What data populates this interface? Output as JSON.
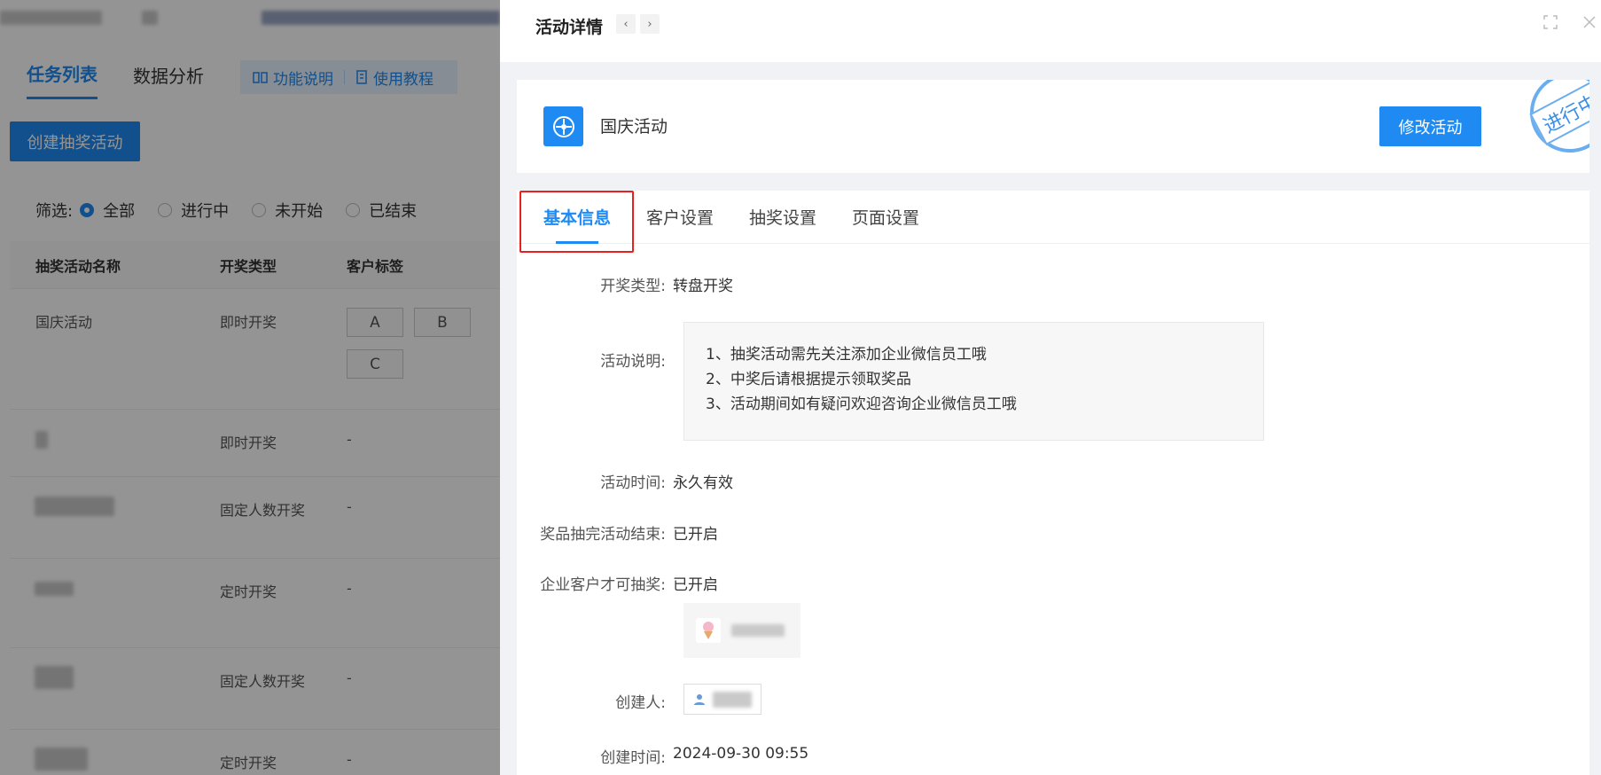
{
  "left": {
    "tabs": [
      "任务列表",
      "数据分析"
    ],
    "help_func": "功能说明",
    "help_tutorial": "使用教程",
    "create_button": "创建抽奖活动",
    "filter_label": "筛选:",
    "filter_options": [
      "全部",
      "进行中",
      "未开始",
      "已结束"
    ],
    "table_headers": [
      "抽奖活动名称",
      "开奖类型",
      "客户标签"
    ],
    "rows": [
      {
        "name": "国庆活动",
        "type": "即时开奖",
        "tags": [
          "A",
          "B",
          "C"
        ]
      },
      {
        "name": "",
        "type": "即时开奖",
        "tag_text": "-"
      },
      {
        "name": "",
        "type": "固定人数开奖",
        "tag_text": "-"
      },
      {
        "name": "",
        "type": "定时开奖",
        "tag_text": "-"
      },
      {
        "name": "",
        "type": "固定人数开奖",
        "tag_text": "-"
      },
      {
        "name": "",
        "type": "定时开奖",
        "tag_text": "-"
      }
    ]
  },
  "drawer": {
    "title": "活动详情",
    "activity_name": "国庆活动",
    "edit_button": "修改活动",
    "stamp": "进行中",
    "tabs": [
      "基本信息",
      "客户设置",
      "抽奖设置",
      "页面设置"
    ],
    "fields": {
      "draw_type_label": "开奖类型:",
      "draw_type_value": "转盘开奖",
      "desc_label": "活动说明:",
      "desc_lines": [
        "1、抽奖活动需先关注添加企业微信员工哦",
        "2、中奖后请根据提示领取奖品",
        "3、活动期间如有疑问欢迎咨询企业微信员工哦"
      ],
      "time_label": "活动时间:",
      "time_value": "永久有效",
      "prize_end_label": "奖品抽完活动结束:",
      "prize_end_value": "已开启",
      "enterprise_only_label": "企业客户才可抽奖:",
      "enterprise_only_value": "已开启",
      "creator_label": "创建人:",
      "created_label": "创建时间:",
      "created_value": "2024-09-30 09:55"
    }
  },
  "colors": {
    "accent": "#1e8af2",
    "highlight": "#e82020"
  }
}
